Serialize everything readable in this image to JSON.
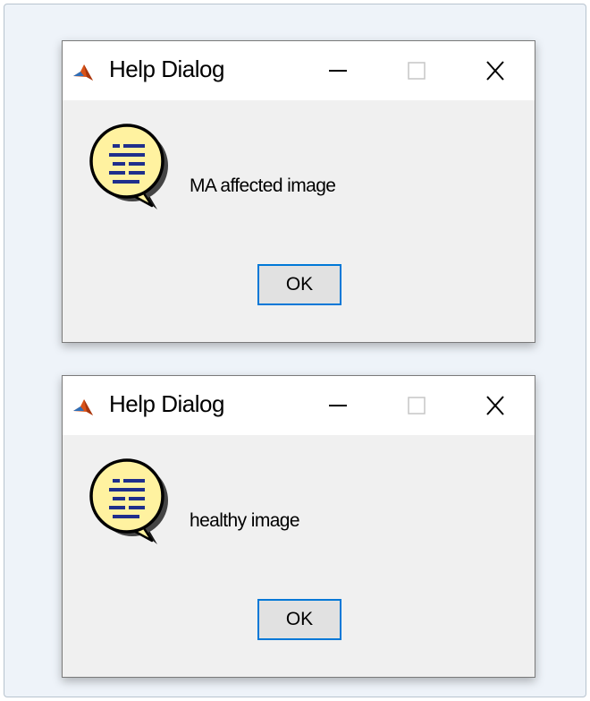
{
  "dialogs": [
    {
      "title": "Help Dialog",
      "message": "MA affected image",
      "ok_label": "OK",
      "icons": {
        "app": "matlab-logo-icon",
        "help": "help-speech-bubble-icon",
        "minimize": "minimize-icon",
        "maximize": "maximize-icon",
        "close": "close-icon"
      }
    },
    {
      "title": "Help Dialog",
      "message": "healthy image",
      "ok_label": "OK",
      "icons": {
        "app": "matlab-logo-icon",
        "help": "help-speech-bubble-icon",
        "minimize": "minimize-icon",
        "maximize": "maximize-icon",
        "close": "close-icon"
      }
    }
  ],
  "colors": {
    "frame_background": "#eef3f9",
    "dialog_body": "#f0f0f0",
    "titlebar": "#ffffff",
    "button_focus_border": "#0078d7",
    "help_bubble_fill": "#fff2a0",
    "help_bubble_lines": "#1f2f8c"
  }
}
